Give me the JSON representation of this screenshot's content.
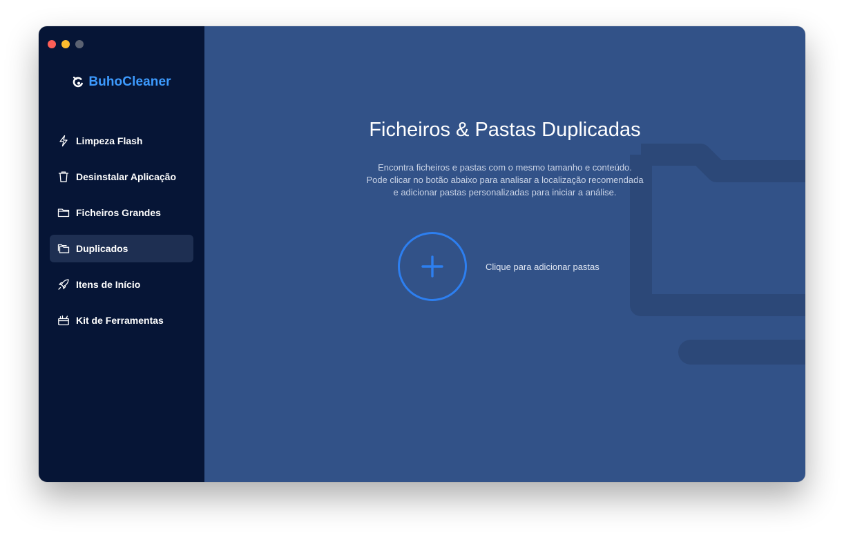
{
  "app": {
    "brand_name": "BuhoCleaner",
    "accent_color": "#3d9bff"
  },
  "sidebar": {
    "items": [
      {
        "label": "Limpeza Flash",
        "icon": "lightning-icon",
        "active": false
      },
      {
        "label": "Desinstalar Aplicação",
        "icon": "trash-icon",
        "active": false
      },
      {
        "label": "Ficheiros Grandes",
        "icon": "folder-icon",
        "active": false
      },
      {
        "label": "Duplicados",
        "icon": "duplicate-folders-icon",
        "active": true
      },
      {
        "label": "Itens de Início",
        "icon": "rocket-icon",
        "active": false
      },
      {
        "label": "Kit de Ferramentas",
        "icon": "toolbox-icon",
        "active": false
      }
    ]
  },
  "main": {
    "title": "Ficheiros & Pastas Duplicadas",
    "description": [
      "Encontra ficheiros e pastas com o mesmo tamanho e conteúdo.",
      "Pode clicar no botão abaixo para analisar a localização recomendada",
      "e adicionar pastas personalizadas para iniciar a análise."
    ],
    "add_label": "Clique para adicionar pastas",
    "add_icon": "plus-icon"
  }
}
